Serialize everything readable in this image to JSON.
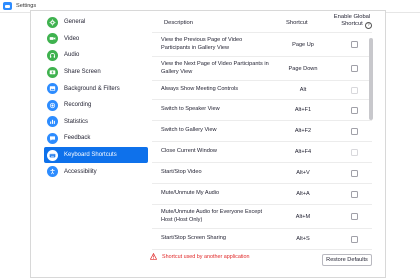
{
  "window": {
    "title": "Settings"
  },
  "sidebar": {
    "items": [
      {
        "label": "General",
        "icon": "gear-icon",
        "color": "#3fb24f",
        "active": false
      },
      {
        "label": "Video",
        "icon": "video-icon",
        "color": "#3fb24f",
        "active": false
      },
      {
        "label": "Audio",
        "icon": "headphones-icon",
        "color": "#3fb24f",
        "active": false
      },
      {
        "label": "Share Screen",
        "icon": "share-screen-icon",
        "color": "#3fb24f",
        "active": false
      },
      {
        "label": "Background & Filters",
        "icon": "background-icon",
        "color": "#2d8cff",
        "active": false
      },
      {
        "label": "Recording",
        "icon": "record-icon",
        "color": "#2d8cff",
        "active": false
      },
      {
        "label": "Statistics",
        "icon": "statistics-icon",
        "color": "#2d8cff",
        "active": false
      },
      {
        "label": "Feedback",
        "icon": "feedback-icon",
        "color": "#2d8cff",
        "active": false
      },
      {
        "label": "Keyboard Shortcuts",
        "icon": "keyboard-icon",
        "color": "#2d8cff",
        "active": true
      },
      {
        "label": "Accessibility",
        "icon": "accessibility-icon",
        "color": "#2d8cff",
        "active": false
      }
    ]
  },
  "table": {
    "headers": {
      "description": "Description",
      "shortcut": "Shortcut",
      "global_line1": "Enable Global",
      "global_line2": "Shortcut"
    },
    "rows": [
      {
        "description": "View the Previous Page of Video Participants in Gallery View",
        "shortcut": "Page Up",
        "global_enabled": true
      },
      {
        "description": "View the Next Page of Video Participants in Gallery View",
        "shortcut": "Page Down",
        "global_enabled": true
      },
      {
        "description": "Always Show Meeting Controls",
        "shortcut": "Alt",
        "global_enabled": false
      },
      {
        "description": "Switch to Speaker View",
        "shortcut": "Alt+F1",
        "global_enabled": true
      },
      {
        "description": "Switch to Gallery View",
        "shortcut": "Alt+F2",
        "global_enabled": true
      },
      {
        "description": "Close Current Window",
        "shortcut": "Alt+F4",
        "global_enabled": false
      },
      {
        "description": "Start/Stop Video",
        "shortcut": "Alt+V",
        "global_enabled": true
      },
      {
        "description": "Mute/Unmute My Audio",
        "shortcut": "Alt+A",
        "global_enabled": true
      },
      {
        "description": "Mute/Unmute Audio for Everyone Except Host (Host Only)",
        "shortcut": "Alt+M",
        "global_enabled": true
      },
      {
        "description": "Start/Stop Screen Sharing",
        "shortcut": "Alt+S",
        "global_enabled": true
      }
    ]
  },
  "footer": {
    "warning": "Shortcut used by another application",
    "warning_color": "#e02828",
    "restore_label": "Restore Defaults"
  },
  "colors": {
    "accent": "#0e71eb"
  }
}
